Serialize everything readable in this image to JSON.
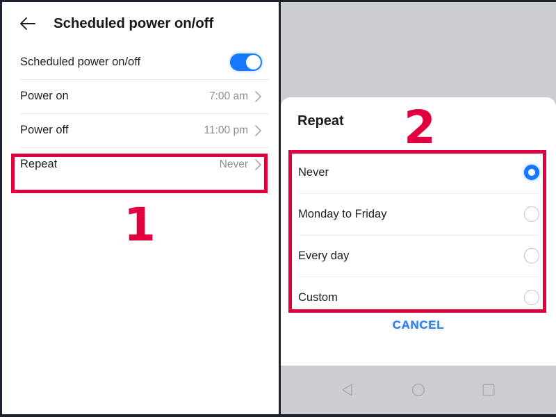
{
  "colors": {
    "accent_blue": "#1677ff",
    "cancel_blue": "#2a7ae8",
    "annotation_red": "#e00040",
    "scrim_grey": "#cccdd0",
    "divider_grey": "#e8e8e8"
  },
  "left_panel": {
    "header": {
      "back_icon": "back-arrow-icon",
      "title": "Scheduled power on/off"
    },
    "rows": [
      {
        "label": "Scheduled power on/off",
        "control": "toggle",
        "toggle_on": true
      },
      {
        "label": "Power on",
        "value": "7:00 am",
        "control": "chevron"
      },
      {
        "label": "Power off",
        "value": "11:00 pm",
        "control": "chevron"
      },
      {
        "label": "Repeat",
        "value": "Never",
        "control": "chevron"
      }
    ]
  },
  "right_panel": {
    "dialog": {
      "title": "Repeat",
      "options": [
        {
          "label": "Never",
          "selected": true
        },
        {
          "label": "Monday to Friday",
          "selected": false
        },
        {
          "label": "Every day",
          "selected": false
        },
        {
          "label": "Custom",
          "selected": false
        }
      ],
      "cancel_label": "CANCEL"
    },
    "navbar": {
      "back": "nav-back-triangle-icon",
      "home": "nav-home-circle-icon",
      "recents": "nav-recents-square-icon"
    }
  },
  "annotations": {
    "step_one": "1",
    "step_two": "2"
  }
}
